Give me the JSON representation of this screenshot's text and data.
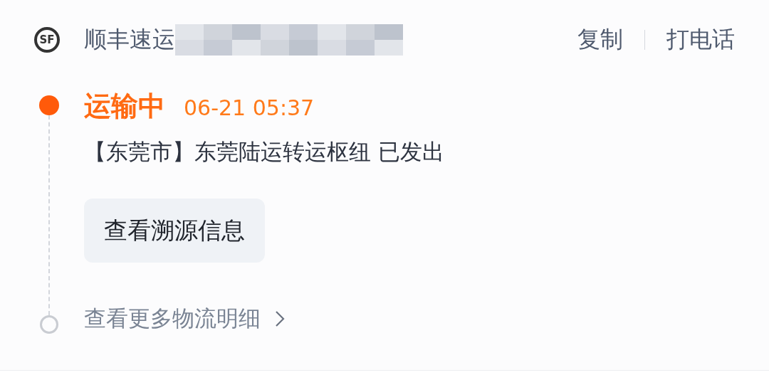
{
  "header": {
    "logo_text": "SF",
    "carrier": "顺丰速运",
    "tracking_number_blurred": true,
    "actions": [
      {
        "label": "复制"
      },
      {
        "label": "打电话"
      }
    ]
  },
  "latest_event": {
    "status": "运输中",
    "time": "06-21 05:37",
    "detail": "【东莞市】东莞陆运转运枢纽 已发出",
    "button": "查看溯源信息"
  },
  "more_link": {
    "label": "查看更多物流明细"
  }
}
